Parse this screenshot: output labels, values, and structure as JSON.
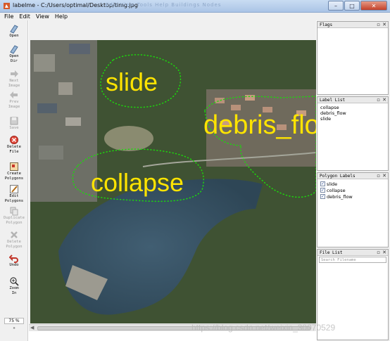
{
  "window": {
    "title": "labelme - C:/Users/optimal/Desktop/timg.jpg",
    "ghost_menu": "Edit   View   Tools   Help   Buildings   Nodes"
  },
  "menu": [
    "File",
    "Edit",
    "View",
    "Help"
  ],
  "toolbar": {
    "open": "Open",
    "open_dir": "Open\nDir",
    "next_image": "Next\nImage",
    "prev_image": "Prev\nImage",
    "save": "Save",
    "delete_file": "Delete\nFile",
    "create_polygons": "Create\nPolygons",
    "edit_polygons": "Edit\nPolygons",
    "duplicate_polygon": "Duplicate\nPolygon",
    "delete_polygon": "Delete\nPolygon",
    "undo": "Undo",
    "zoom_in": "Zoom\nIn",
    "zoom_value": "75 %"
  },
  "canvas": {
    "labels": [
      "slide",
      "debris_flo",
      "collapse"
    ]
  },
  "docks": {
    "flags": {
      "title": "Flags"
    },
    "label_list": {
      "title": "Label List",
      "items": [
        "collapse",
        "debris_flow",
        "slide"
      ]
    },
    "polygon_labels": {
      "title": "Polygon Labels",
      "items": [
        {
          "label": "slide",
          "checked": true
        },
        {
          "label": "collapse",
          "checked": true
        },
        {
          "label": "debris_flow",
          "checked": true
        }
      ]
    },
    "file_list": {
      "title": "File List",
      "search_placeholder": "Search Filename"
    }
  },
  "watermark": "https://blog.csdn.net/weixin_30070529",
  "colors": {
    "polygon": "#22e010",
    "label_text": "#ffe400",
    "water": "#3b5668",
    "forest": "#3e5232"
  }
}
